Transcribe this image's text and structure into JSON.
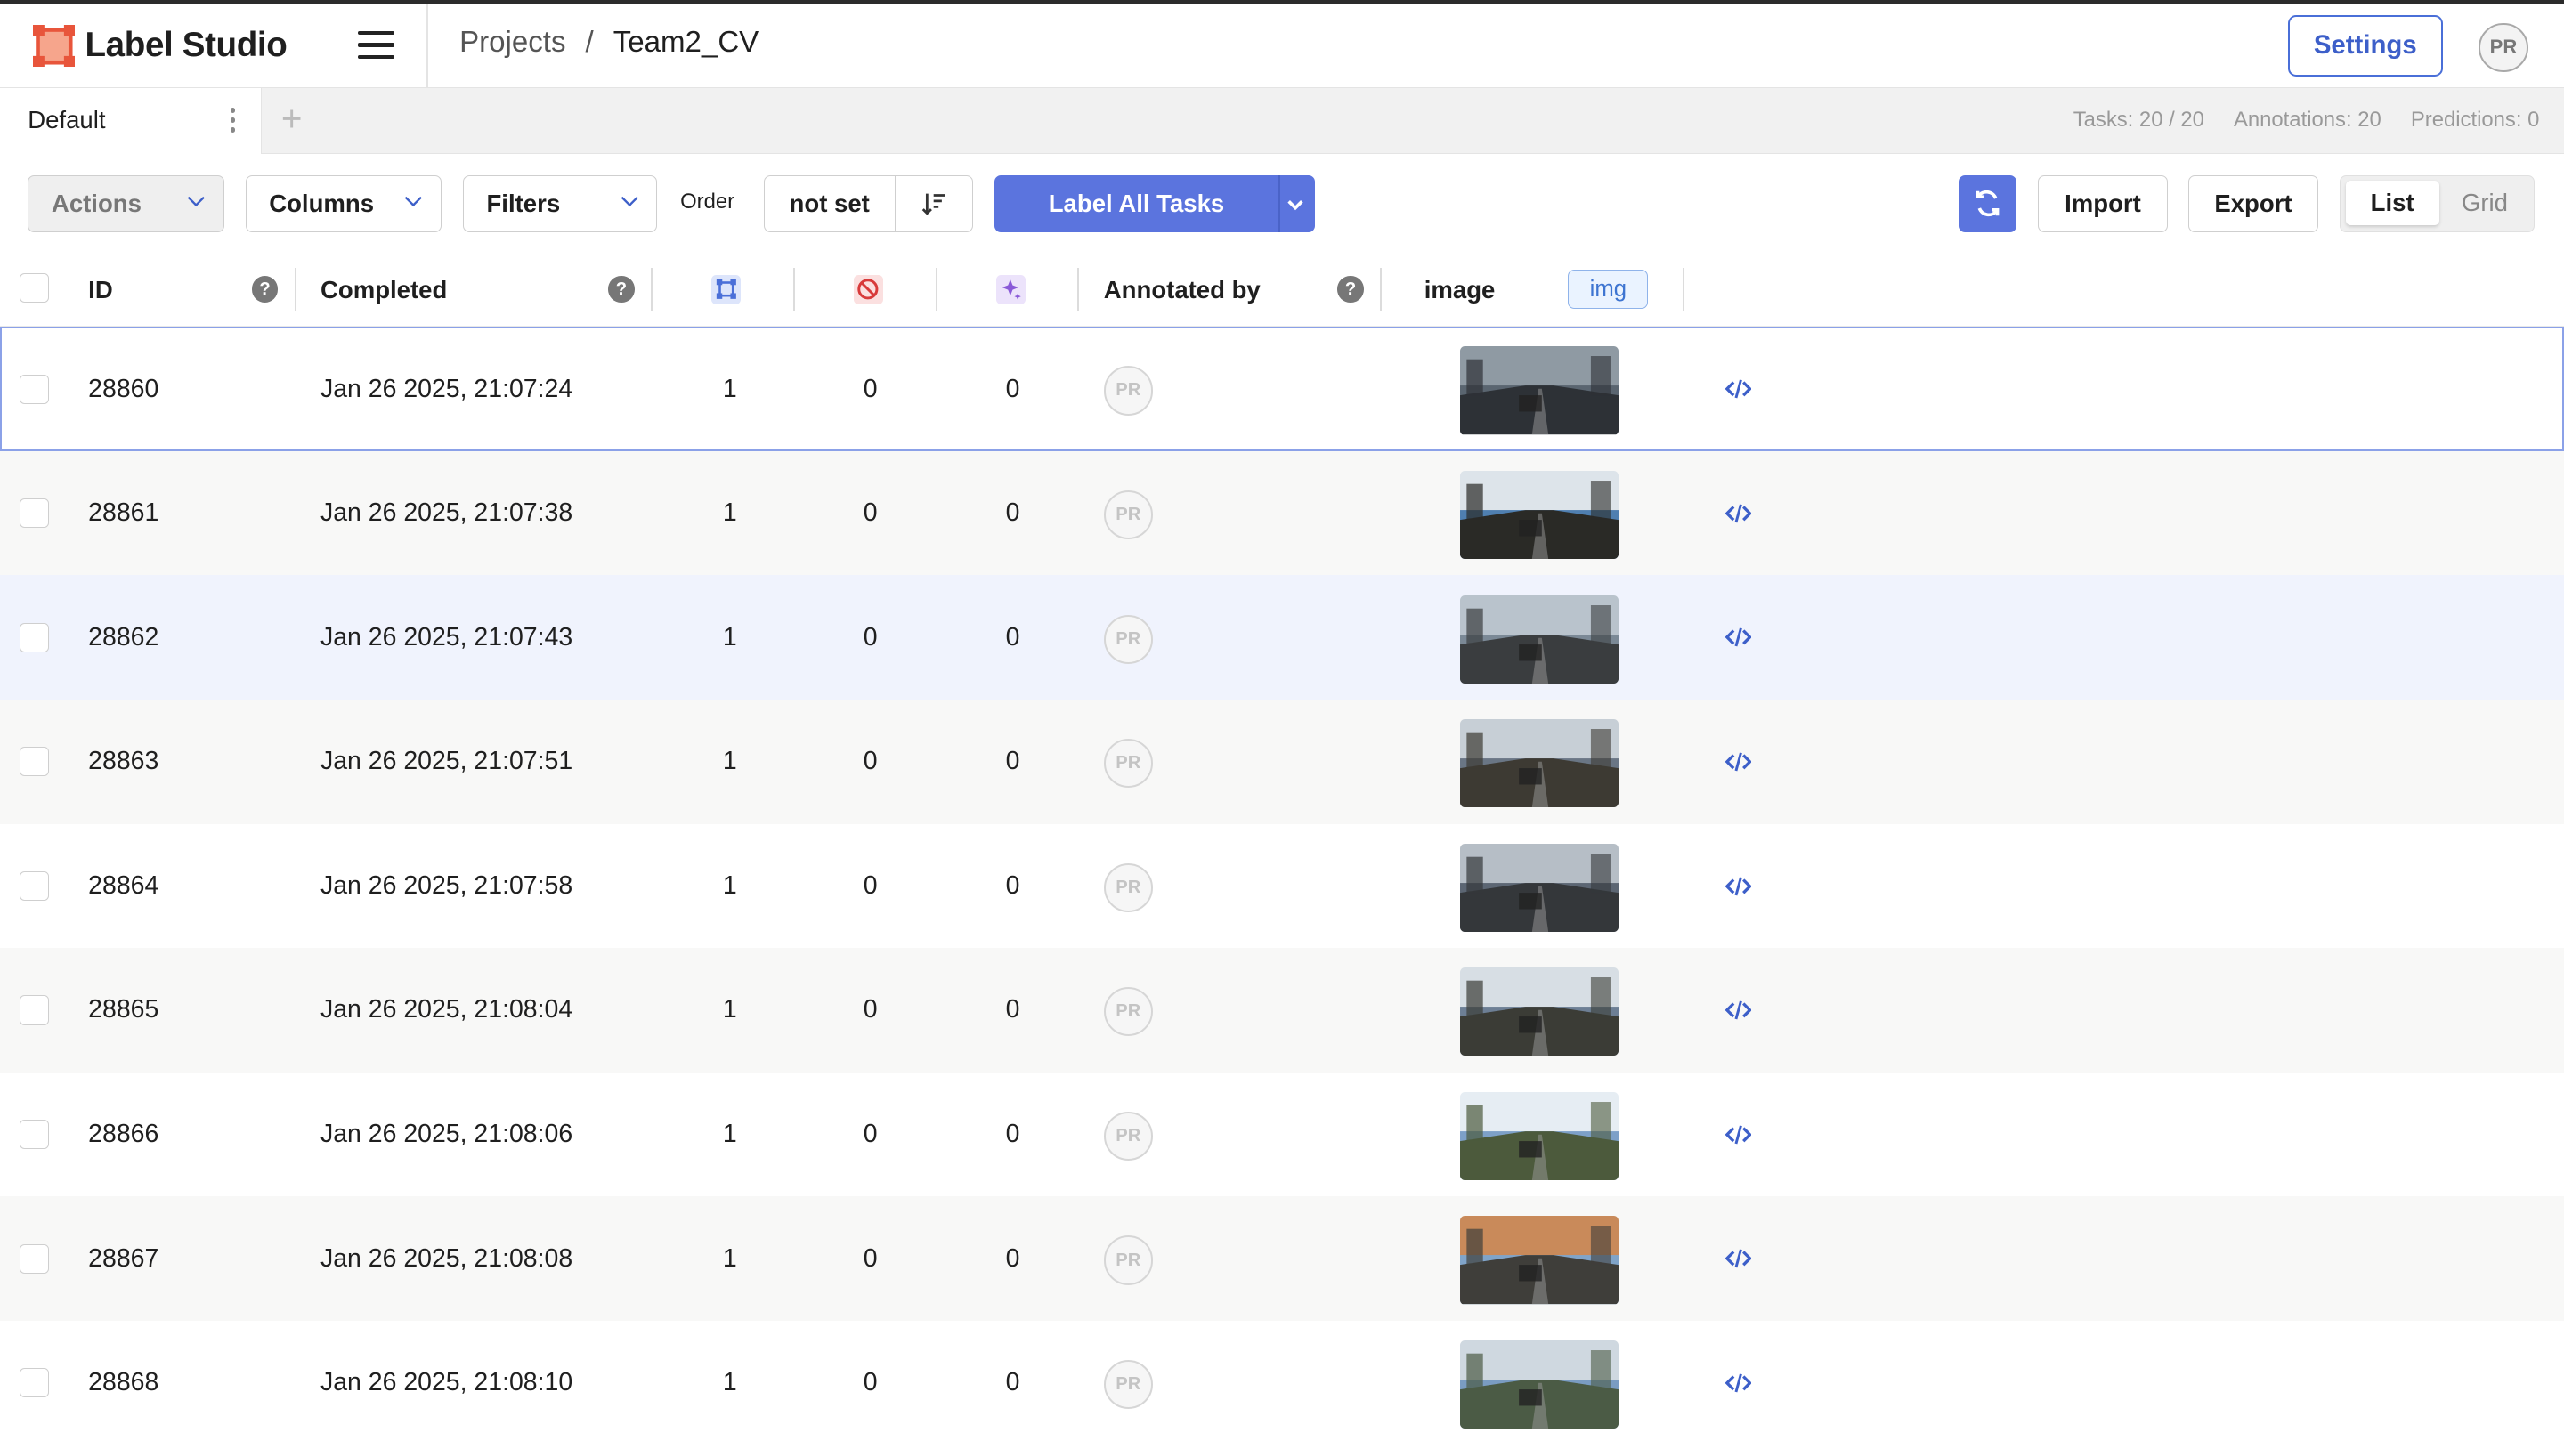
{
  "app": {
    "name": "Label Studio",
    "breadcrumb": [
      "Projects",
      "/",
      "Team2_CV"
    ],
    "settings_label": "Settings",
    "user_initials": "PR"
  },
  "tabs": {
    "active": "Default",
    "add_icon": "plus-icon",
    "stats": {
      "tasks": "Tasks: 20 / 20",
      "annotations": "Annotations: 20",
      "predictions": "Predictions: 0"
    }
  },
  "toolbar": {
    "actions_label": "Actions",
    "columns_label": "Columns",
    "filters_label": "Filters",
    "order_label": "Order",
    "order_value": "not set",
    "label_all_label": "Label All Tasks",
    "import_label": "Import",
    "export_label": "Export",
    "view_list": "List",
    "view_grid": "Grid",
    "accent": "#5b74de"
  },
  "table": {
    "headers": {
      "id": "ID",
      "completed": "Completed",
      "annotated_by": "Annotated by",
      "image": "image",
      "image_tag": "img"
    },
    "header_icons": [
      "annotations-count-icon",
      "cancelled-icon",
      "predictions-icon"
    ],
    "rows": [
      {
        "id": "28860",
        "completed": "Jan 26 2025, 21:07:24",
        "annotations": "1",
        "cancelled": "0",
        "predictions": "0",
        "annotator": "PR"
      },
      {
        "id": "28861",
        "completed": "Jan 26 2025, 21:07:38",
        "annotations": "1",
        "cancelled": "0",
        "predictions": "0",
        "annotator": "PR"
      },
      {
        "id": "28862",
        "completed": "Jan 26 2025, 21:07:43",
        "annotations": "1",
        "cancelled": "0",
        "predictions": "0",
        "annotator": "PR"
      },
      {
        "id": "28863",
        "completed": "Jan 26 2025, 21:07:51",
        "annotations": "1",
        "cancelled": "0",
        "predictions": "0",
        "annotator": "PR"
      },
      {
        "id": "28864",
        "completed": "Jan 26 2025, 21:07:58",
        "annotations": "1",
        "cancelled": "0",
        "predictions": "0",
        "annotator": "PR"
      },
      {
        "id": "28865",
        "completed": "Jan 26 2025, 21:08:04",
        "annotations": "1",
        "cancelled": "0",
        "predictions": "0",
        "annotator": "PR"
      },
      {
        "id": "28866",
        "completed": "Jan 26 2025, 21:08:06",
        "annotations": "1",
        "cancelled": "0",
        "predictions": "0",
        "annotator": "PR"
      },
      {
        "id": "28867",
        "completed": "Jan 26 2025, 21:08:08",
        "annotations": "1",
        "cancelled": "0",
        "predictions": "0",
        "annotator": "PR"
      },
      {
        "id": "28868",
        "completed": "Jan 26 2025, 21:08:10",
        "annotations": "1",
        "cancelled": "0",
        "predictions": "0",
        "annotator": "PR"
      }
    ]
  }
}
